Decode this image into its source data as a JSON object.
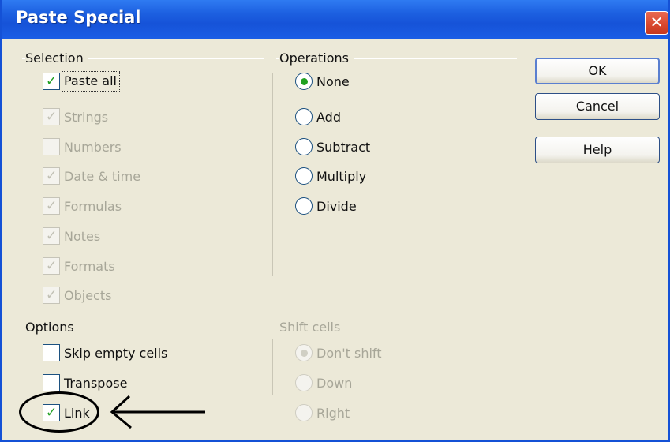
{
  "window": {
    "title": "Paste Special",
    "close_glyph": "✕"
  },
  "selection": {
    "label": "Selection",
    "items": [
      {
        "label": "Paste all",
        "checked": true,
        "enabled": true
      },
      {
        "label": "Strings",
        "checked": true,
        "enabled": false
      },
      {
        "label": "Numbers",
        "checked": false,
        "enabled": false
      },
      {
        "label": "Date & time",
        "checked": true,
        "enabled": false
      },
      {
        "label": "Formulas",
        "checked": true,
        "enabled": false
      },
      {
        "label": "Notes",
        "checked": true,
        "enabled": false
      },
      {
        "label": "Formats",
        "checked": true,
        "enabled": false
      },
      {
        "label": "Objects",
        "checked": true,
        "enabled": false
      }
    ]
  },
  "operations": {
    "label": "Operations",
    "items": [
      {
        "label": "None",
        "selected": true
      },
      {
        "label": "Add",
        "selected": false
      },
      {
        "label": "Subtract",
        "selected": false
      },
      {
        "label": "Multiply",
        "selected": false
      },
      {
        "label": "Divide",
        "selected": false
      }
    ]
  },
  "options": {
    "label": "Options",
    "items": [
      {
        "label": "Skip empty cells",
        "checked": false
      },
      {
        "label": "Transpose",
        "checked": false
      },
      {
        "label": "Link",
        "checked": true
      }
    ]
  },
  "shift_cells": {
    "label": "Shift cells",
    "items": [
      {
        "label": "Don't shift",
        "selected": true
      },
      {
        "label": "Down",
        "selected": false
      },
      {
        "label": "Right",
        "selected": false
      }
    ]
  },
  "buttons": {
    "ok": "OK",
    "cancel": "Cancel",
    "help": "Help"
  },
  "glyphs": {
    "check": "✓"
  },
  "colors": {
    "titlebar": "#1653d8",
    "check": "#21a121",
    "annotation": "#000000"
  }
}
